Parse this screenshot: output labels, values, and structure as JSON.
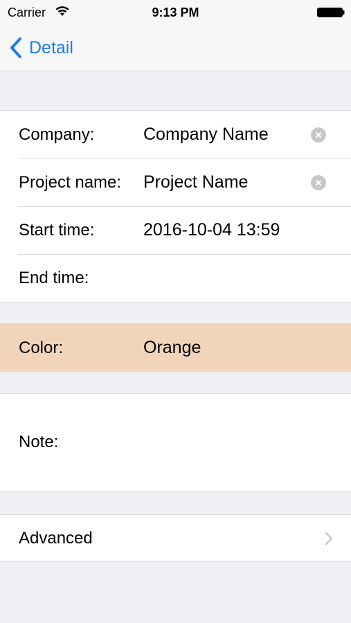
{
  "status_bar": {
    "carrier": "Carrier",
    "time": "9:13 PM",
    "wifi_icon": "wifi-icon",
    "battery_icon": "battery-icon"
  },
  "nav": {
    "back_label": "Detail",
    "back_icon": "chevron-left-icon",
    "accent_color": "#1a7cf5"
  },
  "form": {
    "company": {
      "label": "Company:",
      "value": "Company Name"
    },
    "project_name": {
      "label": "Project name:",
      "value": "Project Name"
    },
    "start_time": {
      "label": "Start time:",
      "value": "2016-10-04 13:59"
    },
    "end_time": {
      "label": "End time:",
      "value": ""
    },
    "color": {
      "label": "Color:",
      "value": "Orange",
      "background": "#f1d4b9"
    },
    "note": {
      "label": "Note:",
      "value": ""
    },
    "advanced": {
      "label": "Advanced"
    }
  }
}
